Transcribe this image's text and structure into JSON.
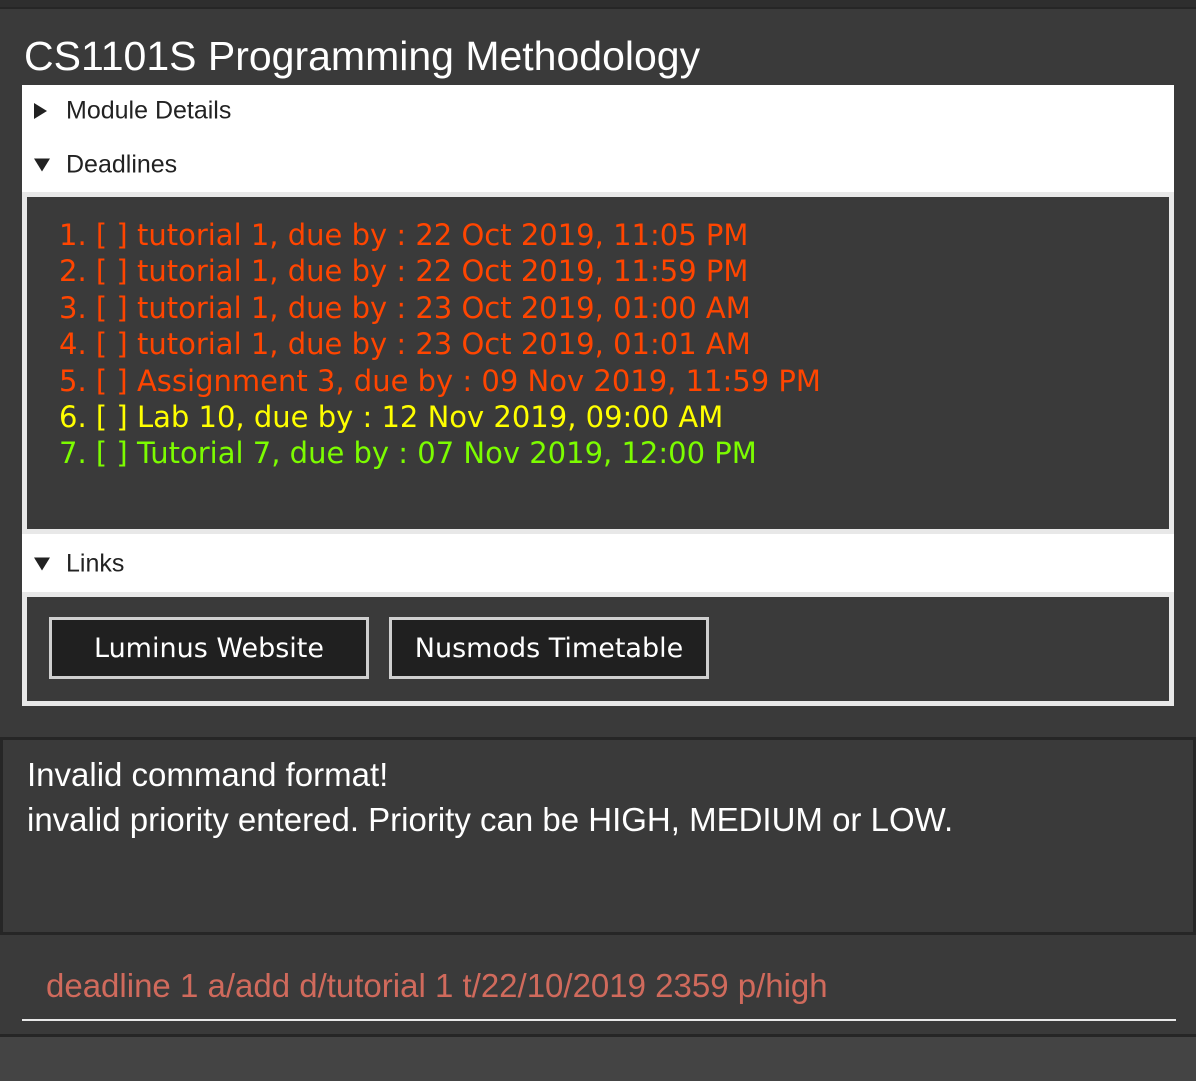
{
  "module": {
    "title": "CS1101S Programming Methodology"
  },
  "sections": {
    "module_details": {
      "label": "Module Details",
      "expanded": false
    },
    "deadlines": {
      "label": "Deadlines",
      "expanded": true
    },
    "links": {
      "label": "Links",
      "expanded": true
    }
  },
  "deadlines": [
    {
      "text": "1. [ ] tutorial 1, due by : 22 Oct 2019, 11:05 PM",
      "color": "#ff4500"
    },
    {
      "text": "2. [ ] tutorial 1, due by : 22 Oct 2019, 11:59 PM",
      "color": "#ff4500"
    },
    {
      "text": "3. [ ] tutorial 1, due by : 23 Oct 2019, 01:00 AM",
      "color": "#ff4500"
    },
    {
      "text": "4. [ ] tutorial 1, due by : 23 Oct 2019, 01:01 AM",
      "color": "#ff4500"
    },
    {
      "text": "5. [ ] Assignment 3, due by : 09 Nov 2019, 11:59 PM",
      "color": "#ff4500"
    },
    {
      "text": "6. [ ] Lab 10, due by : 12 Nov 2019, 09:00 AM",
      "color": "#ffff00"
    },
    {
      "text": "7. [ ] Tutorial 7, due by : 07 Nov 2019, 12:00 PM",
      "color": "#7cfc00"
    }
  ],
  "links": {
    "luminus_label": "Luminus Website",
    "nusmods_label": "Nusmods Timetable"
  },
  "result": {
    "line1": "Invalid command format!",
    "line2": "invalid priority entered. Priority can be HIGH, MEDIUM or LOW."
  },
  "command": {
    "value": "deadline 1 a/add d/tutorial 1 t/22/10/2019 2359 p/high"
  }
}
